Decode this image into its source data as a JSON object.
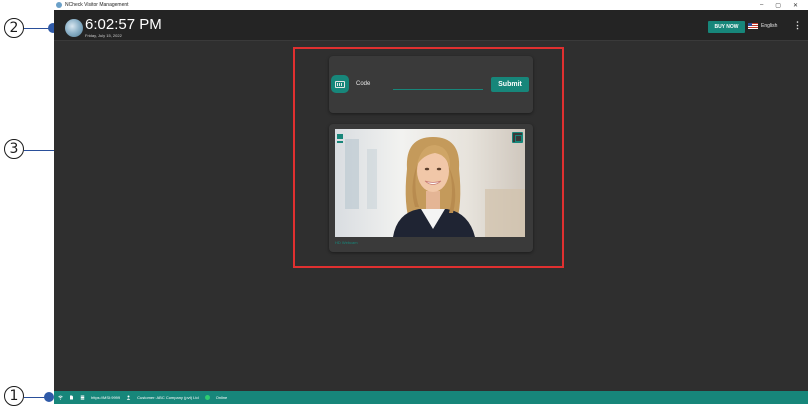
{
  "callouts": [
    "1",
    "2",
    "3"
  ],
  "window": {
    "title": "NCheck Visitor Management",
    "minimize": "–",
    "maximize": "▢",
    "close": "✕"
  },
  "header": {
    "time": "6:02:57 PM",
    "date": "Friday, July 15, 2022",
    "buy_label": "BUY NOW",
    "language": "English",
    "more": "⋮"
  },
  "code_panel": {
    "label": "Code",
    "value": "",
    "submit_label": "Submit"
  },
  "camera": {
    "name": "HD Webcam"
  },
  "statusbar": {
    "server": "https://MSI:9999",
    "customer": "Customer: ABC Company (pvt) Ltd",
    "status": "Online"
  },
  "colors": {
    "accent": "#17867a",
    "background": "#2f2f2f",
    "header": "#242424",
    "card": "#3a3a3a",
    "highlight": "#e03030",
    "callout_dot": "#2f5aa8"
  }
}
